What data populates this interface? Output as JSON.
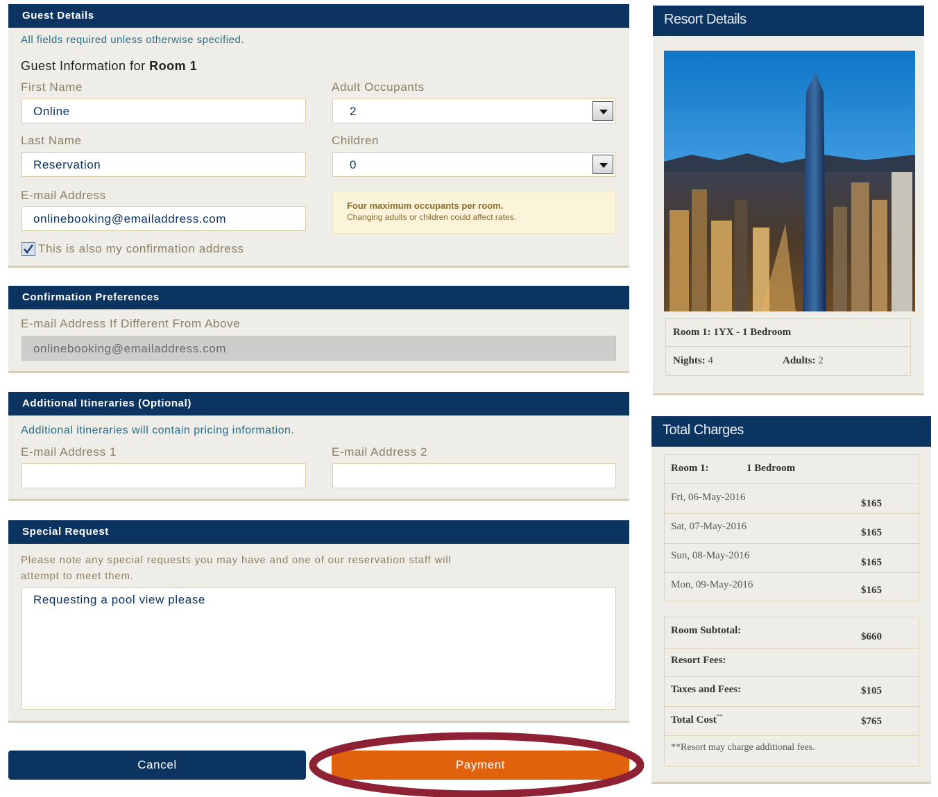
{
  "guest_details": {
    "header": "Guest Details",
    "required_note": "All fields required unless otherwise specified.",
    "room_title_prefix": "Guest Information for",
    "room_title_room": "Room 1",
    "first_name_label": "First Name",
    "first_name_value": "Online",
    "last_name_label": "Last Name",
    "last_name_value": "Reservation",
    "email_label": "E-mail Address",
    "email_value": "onlinebooking@emailaddress.com",
    "confirm_checkbox_label": "This is also my confirmation address",
    "confirm_checked": true,
    "adults_label": "Adult Occupants",
    "adults_value": "2",
    "children_label": "Children",
    "children_value": "0",
    "occupancy_note_line1": "Four maximum occupants per room.",
    "occupancy_note_line2": "Changing adults or children could affect rates."
  },
  "confirmation_preferences": {
    "header": "Confirmation Preferences",
    "email_label": "E-mail Address If Different From Above",
    "email_value": "onlinebooking@emailaddress.com"
  },
  "additional_itineraries": {
    "header": "Additional Itineraries (Optional)",
    "note": "Additional itineraries will contain pricing information.",
    "email1_label": "E-mail Address 1",
    "email1_value": "",
    "email2_label": "E-mail Address 2",
    "email2_value": ""
  },
  "special_request": {
    "header": "Special Request",
    "note_line1": "Please note any special requests you may have and one of our reservation staff will",
    "note_line2": "attempt to meet them.",
    "value": "Requesting a pool view please"
  },
  "buttons": {
    "cancel": "Cancel",
    "payment": "Payment"
  },
  "resort_details": {
    "header": "Resort Details",
    "room_label": "Room 1: 1YX - 1 Bedroom",
    "nights_label": "Nights:",
    "nights_value": "4",
    "adults_label": "Adults:",
    "adults_value": "2"
  },
  "total_charges": {
    "header": "Total Charges",
    "room_label": "Room 1:",
    "room_type": "1 Bedroom",
    "nights": [
      {
        "date": "Fri, 06-May-2016",
        "amount": "$165"
      },
      {
        "date": "Sat, 07-May-2016",
        "amount": "$165"
      },
      {
        "date": "Sun, 08-May-2016",
        "amount": "$165"
      },
      {
        "date": "Mon, 09-May-2016",
        "amount": "$165"
      }
    ],
    "room_subtotal_label": "Room Subtotal:",
    "room_subtotal_value": "$660",
    "resort_fees_label": "Resort Fees:",
    "resort_fees_value": "",
    "taxes_label": "Taxes and Fees:",
    "taxes_value": "$105",
    "total_label": "Total Cost",
    "total_marker": "**",
    "total_value": "$765",
    "footnote": "**Resort may charge additional fees."
  },
  "colors": {
    "navy": "#0b3560",
    "orange": "#e0620c",
    "highlight_ring": "#8e2234",
    "panel_bg": "#efede8"
  }
}
